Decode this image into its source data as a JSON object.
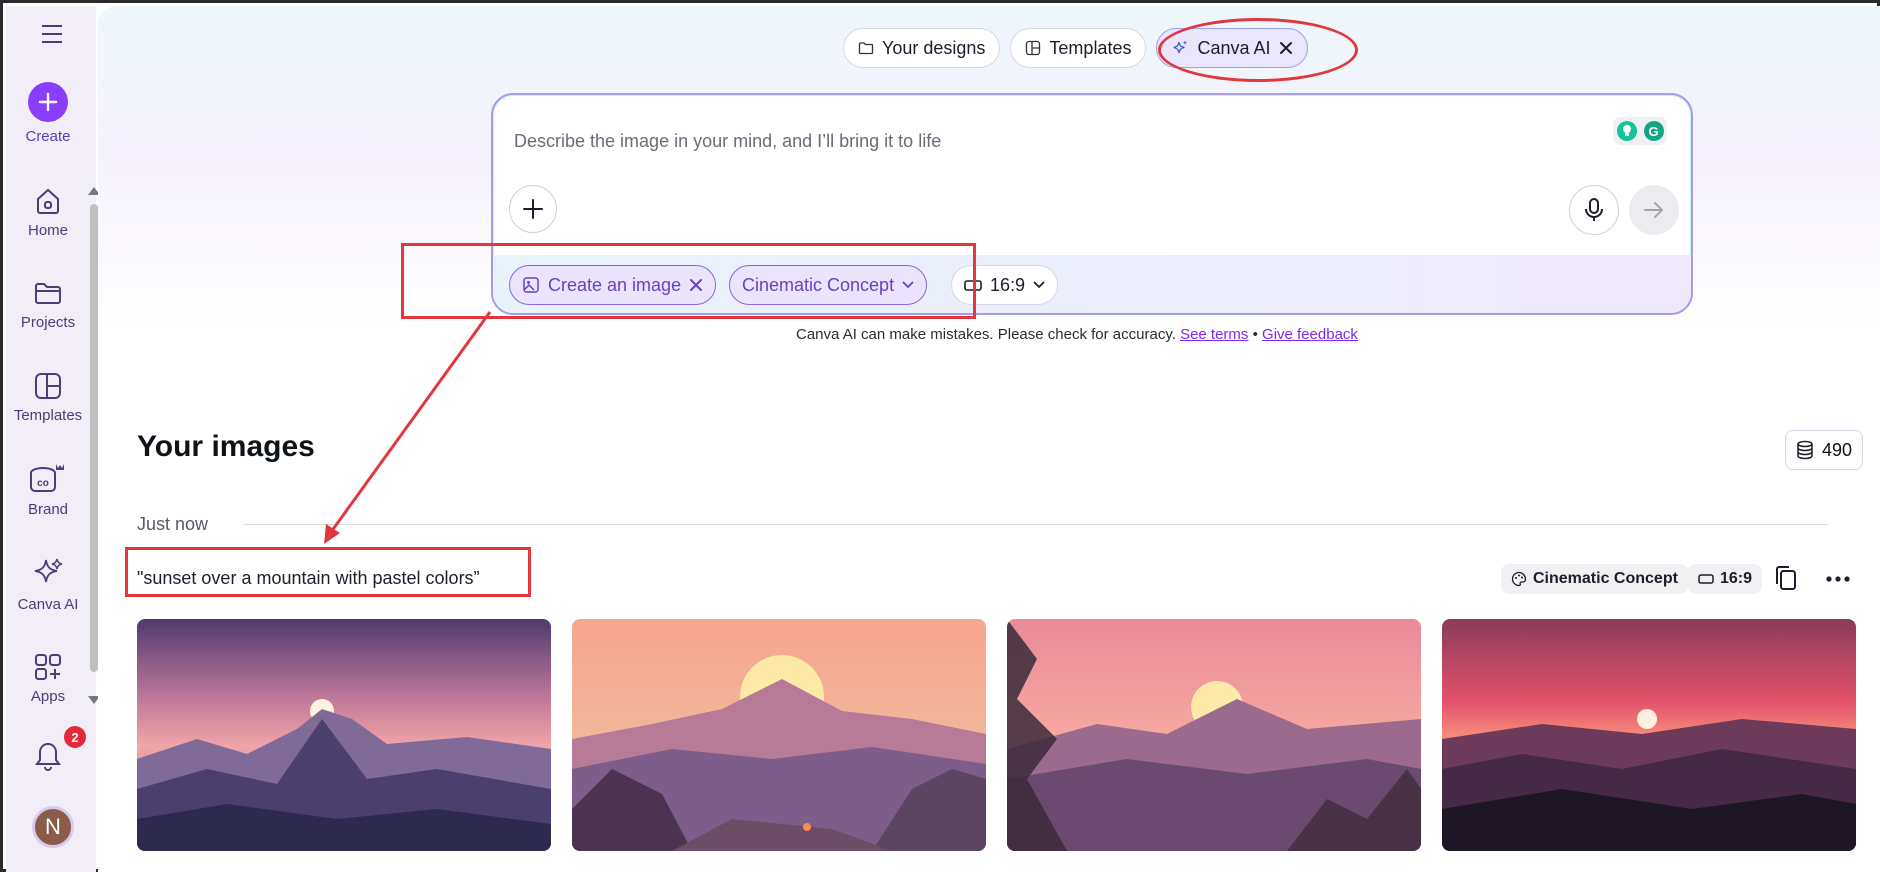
{
  "sidebar": {
    "create_label": "Create",
    "items": [
      {
        "label": "Home",
        "icon": "home-icon"
      },
      {
        "label": "Projects",
        "icon": "folder-icon"
      },
      {
        "label": "Templates",
        "icon": "templates-icon"
      },
      {
        "label": "Brand",
        "icon": "brand-icon"
      },
      {
        "label": "Canva AI",
        "icon": "sparkle-icon"
      },
      {
        "label": "Apps",
        "icon": "apps-icon"
      }
    ],
    "notification_count": "2",
    "avatar_initial": "N"
  },
  "tabs": [
    {
      "label": "Your designs",
      "icon": "folder-icon"
    },
    {
      "label": "Templates",
      "icon": "templates-icon"
    },
    {
      "label": "Canva AI",
      "icon": "sparkle-icon",
      "active": true
    }
  ],
  "prompt": {
    "placeholder": "Describe the image in your mind, and I’ll bring it to life",
    "chips": {
      "mode": "Create an image",
      "style": "Cinematic Concept",
      "ratio": "16:9"
    }
  },
  "disclaimer": {
    "text": "Canva AI can make mistakes. Please check for accuracy.",
    "terms_link": "See terms",
    "separator": "•",
    "feedback_link": "Give feedback"
  },
  "images_section": {
    "title": "Your images",
    "credits": "490",
    "time_label": "Just now",
    "prompt_text": "\"sunset over a mountain with pastel colors”",
    "style_chip": "Cinematic Concept",
    "ratio_chip": "16:9"
  },
  "help_label": "?",
  "colors": {
    "accent": "#8b3dff",
    "annotation": "#e0383e",
    "badge": "#e5283b"
  }
}
